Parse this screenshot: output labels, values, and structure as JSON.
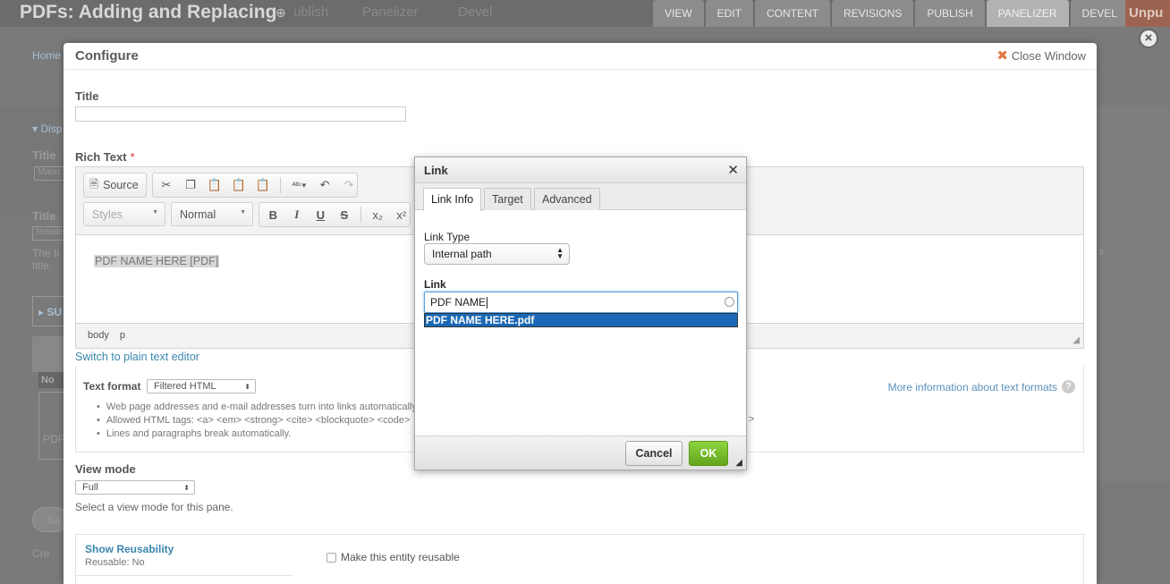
{
  "background": {
    "page_title": "PDFs: Adding and Replacing",
    "faint_tabs": [
      "ublish",
      "Panelizer",
      "Devel"
    ],
    "tabs": [
      "VIEW",
      "EDIT",
      "CONTENT",
      "REVISIONS",
      "PUBLISH",
      "PANELIZER",
      "DEVEL"
    ],
    "active_tab": "PANELIZER",
    "unpublished_badge": "Unpu",
    "breadcrumb_home": "Home",
    "peek": {
      "disp": "▾ Disp",
      "title1": "Title",
      "manu": "Manu",
      "title2": "Title",
      "node": "%node",
      "the_t": "The ti title.",
      "su": "▸ SU",
      "no": "No",
      "pdf": "PDF",
      "sa": "Sa",
      "cre": "Cre",
      "right_s": "s",
      "right_gt": ">"
    }
  },
  "configure": {
    "title": "Configure",
    "close_label": "Close Window",
    "title_label": "Title",
    "title_value": "",
    "rich_text_label": "Rich Text",
    "required_mark": "*",
    "toolbar": {
      "source_label": "Source",
      "styles_label": "Styles",
      "format_label": "Normal",
      "bold": "B",
      "italic": "I",
      "underline": "U",
      "strike": "S",
      "subscript": "x₂",
      "superscript": "x²"
    },
    "editor_content": "PDF NAME HERE [PDF]",
    "status_path": [
      "body",
      "p"
    ],
    "switch_editor_link": "Switch to plain text editor",
    "text_format_label": "Text format",
    "text_format_value": "Filtered HTML",
    "more_info_link": "More information about text formats",
    "format_tips": [
      "Web page addresses and e-mail addresses turn into links automatically.",
      "Allowed HTML tags: <a> <em> <strong> <cite> <blockquote> <code>",
      "Lines and paragraphs break automatically."
    ],
    "view_mode_label": "View mode",
    "view_mode_value": "Full",
    "view_mode_hint": "Select a view mode for this pane.",
    "show_reusability_link": "Show Reusability",
    "reusable_status": "Reusable: No",
    "make_reusable_label": "Make this entity reusable"
  },
  "link_dialog": {
    "title": "Link",
    "tabs": [
      "Link Info",
      "Target",
      "Advanced"
    ],
    "active_tab": "Link Info",
    "link_type_label": "Link Type",
    "link_type_value": "Internal path",
    "link_label": "Link",
    "link_value": "PDF NAME",
    "autocomplete_suggestion": "PDF NAME HERE.pdf",
    "cancel_label": "Cancel",
    "ok_label": "OK"
  },
  "colors": {
    "ok_button": "#63a51c",
    "autocomplete_highlight": "#1b69b6",
    "link_blue": "#3a87ad",
    "close_x": "#e07a45",
    "overlay": "#7f7f7f"
  }
}
